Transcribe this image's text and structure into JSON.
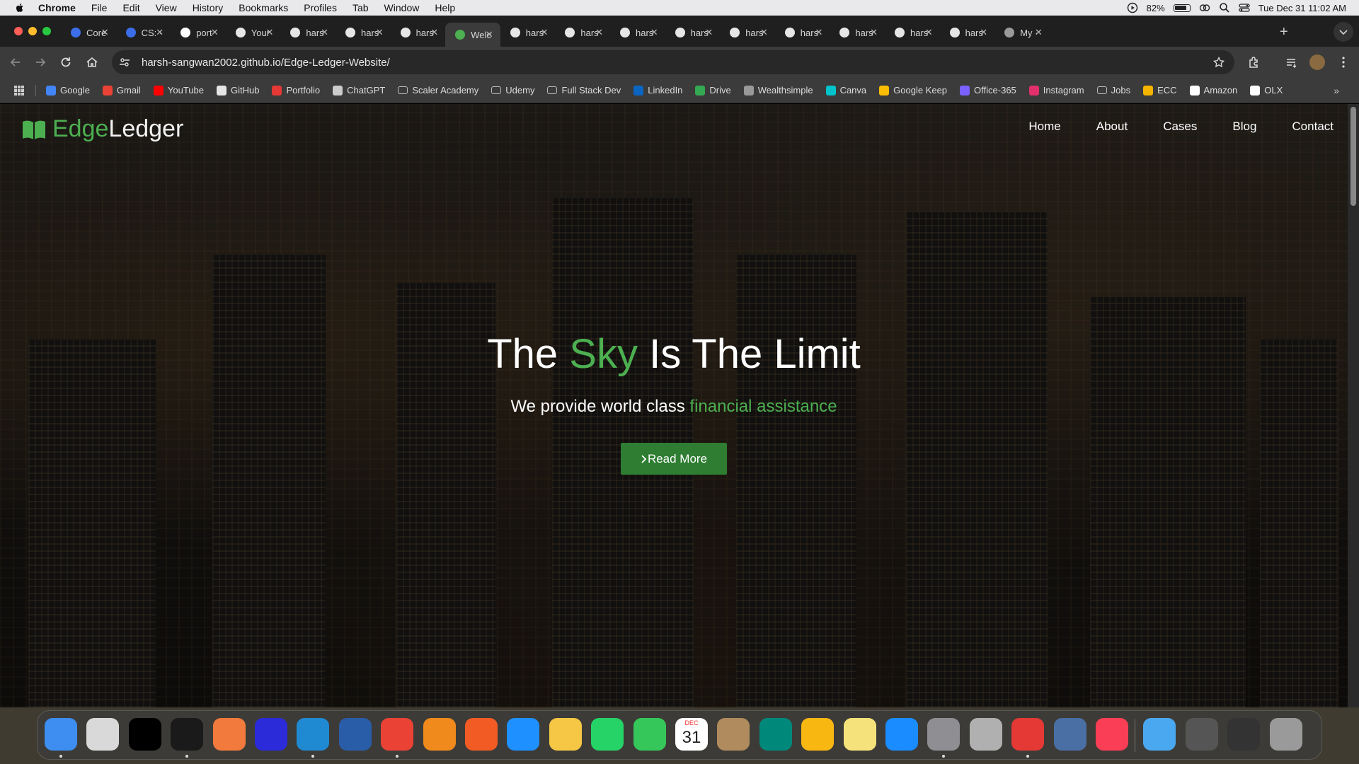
{
  "menubar": {
    "app": "Chrome",
    "items": [
      "File",
      "Edit",
      "View",
      "History",
      "Bookmarks",
      "Profiles",
      "Tab",
      "Window",
      "Help"
    ],
    "battery": "82%",
    "datetime": "Tue Dec 31  11:02 AM"
  },
  "tabs": [
    {
      "label": "Core",
      "icon": "doc-icon",
      "color": "#3b6ee8"
    },
    {
      "label": "CS: ·",
      "icon": "doc-icon",
      "color": "#3b6ee8"
    },
    {
      "label": "port",
      "icon": "vercel-icon",
      "color": "#ffffff"
    },
    {
      "label": "Your",
      "icon": "github-icon",
      "color": "#e6e6e6"
    },
    {
      "label": "hars",
      "icon": "github-icon",
      "color": "#e6e6e6"
    },
    {
      "label": "hars",
      "icon": "github-icon",
      "color": "#e6e6e6"
    },
    {
      "label": "hars",
      "icon": "github-icon",
      "color": "#e6e6e6"
    },
    {
      "label": "Welc",
      "icon": "site-icon",
      "color": "#4caf50",
      "active": true
    },
    {
      "label": "hars",
      "icon": "github-icon",
      "color": "#e6e6e6"
    },
    {
      "label": "hars",
      "icon": "github-icon",
      "color": "#e6e6e6"
    },
    {
      "label": "hars",
      "icon": "github-icon",
      "color": "#e6e6e6"
    },
    {
      "label": "hars",
      "icon": "github-icon",
      "color": "#e6e6e6"
    },
    {
      "label": "hars",
      "icon": "github-icon",
      "color": "#e6e6e6"
    },
    {
      "label": "hars",
      "icon": "github-icon",
      "color": "#e6e6e6"
    },
    {
      "label": "hars",
      "icon": "github-icon",
      "color": "#e6e6e6"
    },
    {
      "label": "hars",
      "icon": "github-icon",
      "color": "#e6e6e6"
    },
    {
      "label": "hars",
      "icon": "github-icon",
      "color": "#e6e6e6"
    },
    {
      "label": "My ·",
      "icon": "globe-icon",
      "color": "#9a9a9a"
    }
  ],
  "omnibox": {
    "url": "harsh-sangwan2002.github.io/Edge-Ledger-Website/"
  },
  "bookmarks": [
    {
      "label": "Google",
      "icon": "google-icon",
      "color": "#4285f4"
    },
    {
      "label": "Gmail",
      "icon": "gmail-icon",
      "color": "#ea4335"
    },
    {
      "label": "YouTube",
      "icon": "youtube-icon",
      "color": "#ff0000"
    },
    {
      "label": "GitHub",
      "icon": "github-icon",
      "color": "#e6e6e6"
    },
    {
      "label": "Portfolio",
      "icon": "youtube-icon",
      "color": "#e53935"
    },
    {
      "label": "ChatGPT",
      "icon": "openai-icon",
      "color": "#cccccc"
    },
    {
      "label": "Scaler Academy",
      "icon": "folder-icon",
      "color": "#bbbbbb"
    },
    {
      "label": "Udemy",
      "icon": "folder-icon",
      "color": "#bbbbbb"
    },
    {
      "label": "Full Stack Dev",
      "icon": "folder-icon",
      "color": "#bbbbbb"
    },
    {
      "label": "LinkedIn",
      "icon": "linkedin-icon",
      "color": "#0a66c2"
    },
    {
      "label": "Drive",
      "icon": "drive-icon",
      "color": "#34a853"
    },
    {
      "label": "Wealthsimple",
      "icon": "w-icon",
      "color": "#999999"
    },
    {
      "label": "Canva",
      "icon": "canva-icon",
      "color": "#00c4cc"
    },
    {
      "label": "Google Keep",
      "icon": "keep-icon",
      "color": "#fbbc04"
    },
    {
      "label": "Office-365",
      "icon": "office-icon",
      "color": "#7b61ff"
    },
    {
      "label": "Instagram",
      "icon": "instagram-icon",
      "color": "#e1306c"
    },
    {
      "label": "Jobs",
      "icon": "folder-icon",
      "color": "#bbbbbb"
    },
    {
      "label": "ECC",
      "icon": "ecc-icon",
      "color": "#f4b400"
    },
    {
      "label": "Amazon",
      "icon": "amazon-icon",
      "color": "#ffffff"
    },
    {
      "label": "OLX",
      "icon": "olx-icon",
      "color": "#ffffff"
    }
  ],
  "site": {
    "logo_edge": "Edge",
    "logo_ledger": "Ledger",
    "nav": [
      "Home",
      "About",
      "Cases",
      "Blog",
      "Contact"
    ],
    "hero_title_pre": "The ",
    "hero_title_accent": "Sky",
    "hero_title_post": " Is The Limit",
    "hero_sub_pre": "We provide world class ",
    "hero_sub_accent": "financial assistance",
    "cta": "Read More",
    "accent": "#4caf50"
  },
  "dock": {
    "apps": [
      {
        "name": "finder-icon",
        "color": "#3d8ef0",
        "running": true
      },
      {
        "name": "launchpad-icon",
        "color": "#d9d9d9",
        "running": false
      },
      {
        "name": "vectorworks-icon",
        "color": "#000000",
        "running": false
      },
      {
        "name": "terminal-icon",
        "color": "#1a1a1a",
        "running": true
      },
      {
        "name": "pen-icon",
        "color": "#f27a3c",
        "running": false
      },
      {
        "name": "intellij-icon",
        "color": "#2b2bd9",
        "running": false
      },
      {
        "name": "vscode-icon",
        "color": "#1f8ad2",
        "running": true
      },
      {
        "name": "wireshark-icon",
        "color": "#2a5da8",
        "running": false
      },
      {
        "name": "chrome-icon",
        "color": "#ea4335",
        "running": true
      },
      {
        "name": "vlc-icon",
        "color": "#f08a1c",
        "running": false
      },
      {
        "name": "brave-icon",
        "color": "#f25c24",
        "running": false
      },
      {
        "name": "safari-icon",
        "color": "#1e90ff",
        "running": false
      },
      {
        "name": "photos-icon",
        "color": "#f6c744",
        "running": false
      },
      {
        "name": "whatsapp-icon",
        "color": "#25d366",
        "running": false
      },
      {
        "name": "facetime-icon",
        "color": "#35c759",
        "running": false
      },
      {
        "name": "calendar-icon",
        "color": "#ffffff",
        "running": false,
        "month": "DEC",
        "day": "31"
      },
      {
        "name": "contacts-icon",
        "color": "#b08b5e",
        "running": false
      },
      {
        "name": "meet-icon",
        "color": "#00897b",
        "running": false
      },
      {
        "name": "keynote-icon",
        "color": "#f9b712",
        "running": false
      },
      {
        "name": "notes-icon",
        "color": "#f6e27a",
        "running": false
      },
      {
        "name": "appstore-icon",
        "color": "#1a8cff",
        "running": false
      },
      {
        "name": "settings-icon",
        "color": "#8e8e93",
        "running": true
      },
      {
        "name": "iphone-mirroring-icon",
        "color": "#b0b0b0",
        "running": false
      },
      {
        "name": "screen-recorder-icon",
        "color": "#e53935",
        "running": true
      },
      {
        "name": "preview-icon",
        "color": "#4a6fa5",
        "running": false
      },
      {
        "name": "music-icon",
        "color": "#fa3e55",
        "running": false
      },
      {
        "name": "downloads-folder-icon",
        "color": "#4aa8f0",
        "running": false
      },
      {
        "name": "stack-icon",
        "color": "#555555",
        "running": false
      },
      {
        "name": "screenshot-icon",
        "color": "#333333",
        "running": false
      },
      {
        "name": "trash-icon",
        "color": "#9a9a9a",
        "running": false
      }
    ]
  }
}
